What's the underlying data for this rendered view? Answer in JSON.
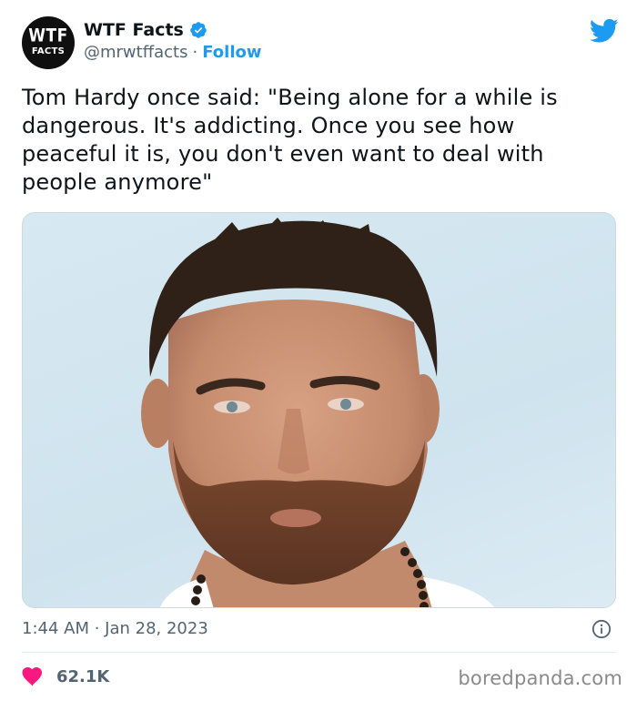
{
  "account": {
    "avatar_line1": "WTF",
    "avatar_line2": "FACTS",
    "display_name": "WTF Facts",
    "handle": "@mrwtffacts",
    "separator": "·",
    "follow_label": "Follow"
  },
  "tweet": {
    "text": "Tom Hardy once said: \"Being alone for a while is dangerous. It's addicting. Once you see how peaceful it is, you don't even want to deal with people anymore\"",
    "timestamp": "1:44 AM · Jan 28, 2023",
    "like_count": "62.1K"
  },
  "watermark": "boredpanda.com",
  "colors": {
    "accent": "#1d9bf0",
    "like": "#f91880",
    "secondary_text": "#536471"
  },
  "icons": {
    "verified": "verified-badge-icon",
    "brand": "twitter-bird-icon",
    "info": "info-icon",
    "like": "heart-icon"
  }
}
